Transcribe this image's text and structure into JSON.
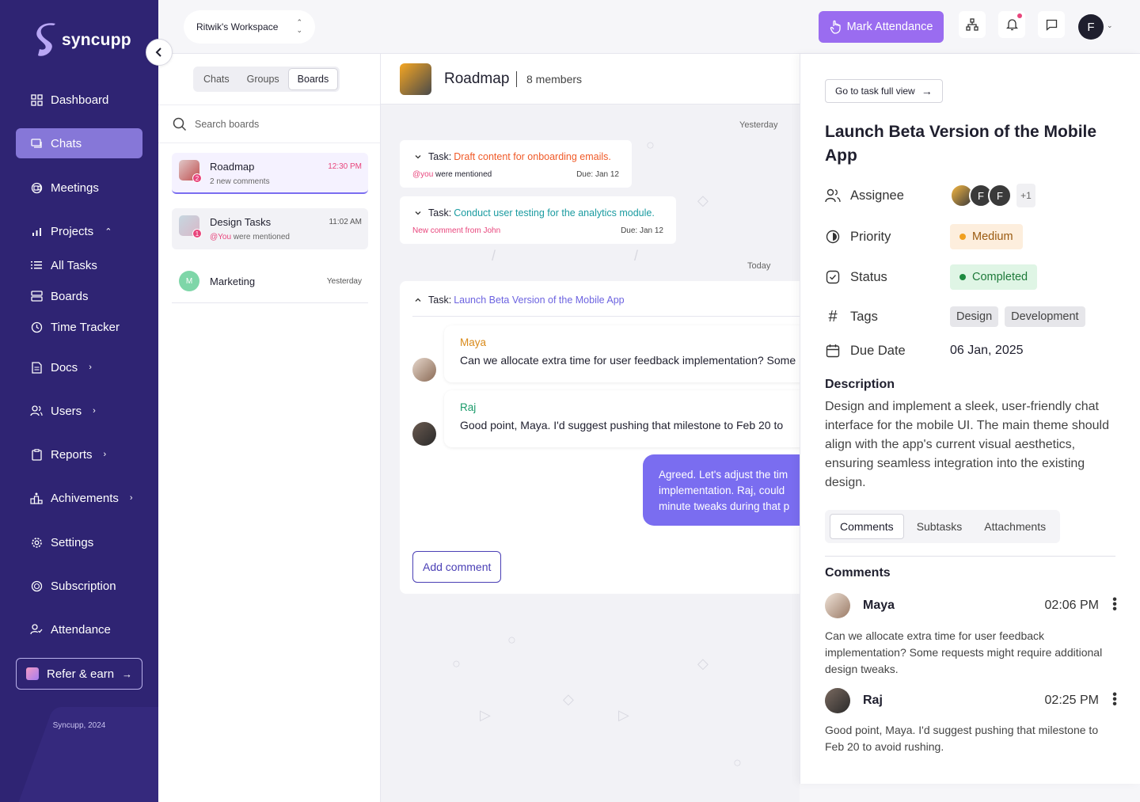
{
  "brand": {
    "name": "syncupp",
    "copyright": "Syncupp, 2024"
  },
  "sidebar": {
    "items": [
      {
        "label": "Dashboard"
      },
      {
        "label": "Chats"
      },
      {
        "label": "Meetings"
      },
      {
        "label": "Projects"
      },
      {
        "label": "All Tasks"
      },
      {
        "label": "Boards"
      },
      {
        "label": "Time Tracker"
      },
      {
        "label": "Docs"
      },
      {
        "label": "Users"
      },
      {
        "label": "Reports"
      },
      {
        "label": "Achivements"
      },
      {
        "label": "Settings"
      },
      {
        "label": "Subscription"
      },
      {
        "label": "Attendance"
      }
    ],
    "refer": "Refer & earn"
  },
  "topbar": {
    "workspace": "Ritwik's Workspace",
    "attendance_button": "Mark Attendance",
    "avatar_initial": "F"
  },
  "list": {
    "tabs": [
      "Chats",
      "Groups",
      "Boards"
    ],
    "search_placeholder": "Search boards",
    "boards": [
      {
        "name": "Roadmap",
        "sub": "2 new comments",
        "time": "12:30 PM",
        "badge": "2"
      },
      {
        "name": "Design Tasks",
        "mention": "@You",
        "sub": " were mentioned",
        "time": "11:02 AM",
        "badge": "1"
      },
      {
        "name": "Marketing",
        "initial": "M",
        "time": "Yesterday"
      }
    ]
  },
  "chat": {
    "title": "Roadmap",
    "members": "8 members",
    "day_yesterday": "Yesterday",
    "day_today": "Today",
    "tasks": [
      {
        "prefix": "Task:",
        "title": "Draft content for onboarding emails.",
        "meta_mention": "@you",
        "meta": " were mentioned",
        "due": "Due: Jan 12"
      },
      {
        "prefix": "Task:",
        "title": "Conduct user testing for the analytics module.",
        "meta": "New comment from John",
        "due": "Due: Jan 12"
      }
    ],
    "open_task": {
      "prefix": "Task:",
      "title": "Launch Beta Version of the Mobile App"
    },
    "messages": [
      {
        "name": "Maya",
        "text": "Can we allocate extra time for user feedback implementation? Some"
      },
      {
        "name": "Raj",
        "text": "Good point, Maya. I'd suggest pushing that milestone to Feb 20 to"
      }
    ],
    "my_message": [
      "Agreed. Let's adjust the tim",
      "implementation. Raj, could",
      "minute tweaks during that p"
    ],
    "add_comment": "Add comment"
  },
  "detail": {
    "go_full": "Go to task full view",
    "title": "Launch Beta Version of the Mobile App",
    "labels": {
      "assignee": "Assignee",
      "priority": "Priority",
      "status": "Status",
      "tags": "Tags",
      "due": "Due Date"
    },
    "assignee_initials": [
      "F",
      "F"
    ],
    "assignee_more": "+1",
    "priority": "Medium",
    "status": "Completed",
    "tags": [
      "Design",
      "Development"
    ],
    "due_date": "06 Jan, 2025",
    "description_heading": "Description",
    "description": "Design and implement a sleek, user-friendly chat interface for the mobile UI. The main theme should align with the app's current visual aesthetics, ensuring seamless integration into the existing design.",
    "tabs": [
      "Comments",
      "Subtasks",
      "Attachments"
    ],
    "comments_heading": "Comments",
    "comments": [
      {
        "name": "Maya",
        "time": "02:06 PM",
        "text": "Can we allocate extra time for user feedback implementation? Some requests might require additional design tweaks."
      },
      {
        "name": "Raj",
        "time": "02:25 PM",
        "text": "Good point, Maya. I'd suggest pushing that milestone to Feb 20 to avoid rushing."
      }
    ]
  },
  "colors": {
    "sidebar": "#2f2473",
    "accent": "#9a6cf0",
    "mention": "#e8457c",
    "task_orange": "#f05a28",
    "task_teal": "#1a9ba0",
    "task_purple": "#6c63e0",
    "maya": "#d98a1a",
    "raj": "#1a9b6a"
  }
}
